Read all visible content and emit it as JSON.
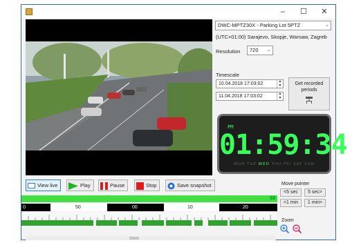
{
  "window": {
    "minimize": "–",
    "maximize": "☐",
    "close": "✕"
  },
  "camera": {
    "selected": "DWC-MPTZ30X - Parking Lot 5PTZ",
    "timezone": "(UTC+01:00) Sarajevo, Skopje, Warsaw, Zagreb"
  },
  "resolution": {
    "label": "Resolution",
    "selected": "720"
  },
  "timescale": {
    "label": "Timescale",
    "start": "10.04.2018 17:03:02",
    "end": "11.04.2018 17:03:02"
  },
  "recorded_button": {
    "label": "Get recorded periods"
  },
  "clock": {
    "ampm": "PM",
    "time": "01:59:34",
    "days": [
      "MON",
      "TUE",
      "WED",
      "THU",
      "FRI",
      "SAT",
      "SUN"
    ],
    "active_day": "WED"
  },
  "toolbar": {
    "view_live": "View live",
    "play": "Play",
    "pause": "Pause",
    "stop": "Stop",
    "save_snapshot": "Save snapshot"
  },
  "move_pointer": {
    "label": "Move pointer",
    "back_5s": "<5 sec",
    "fwd_5s": "5 sec>",
    "back_1m": "<1 min",
    "fwd_1m": "1 min>"
  },
  "timeline": {
    "current_hour": "03",
    "hours": [
      "0",
      "50",
      "00",
      "10",
      "20"
    ]
  },
  "zoom": {
    "label": "Zoom"
  },
  "colors": {
    "clock_green": "#39ff5c",
    "timeline_green": "#3fe03f",
    "recorded_green": "#2fa22f",
    "accent": "#2a7de1"
  },
  "icons": {
    "app": "app-icon",
    "view_live": "monitor-icon",
    "play": "play-icon",
    "pause": "pause-icon",
    "stop": "stop-icon",
    "save": "camera-icon",
    "zoom_in": "zoom-in-icon",
    "zoom_out": "zoom-out-icon",
    "recorded": "network-icon"
  }
}
